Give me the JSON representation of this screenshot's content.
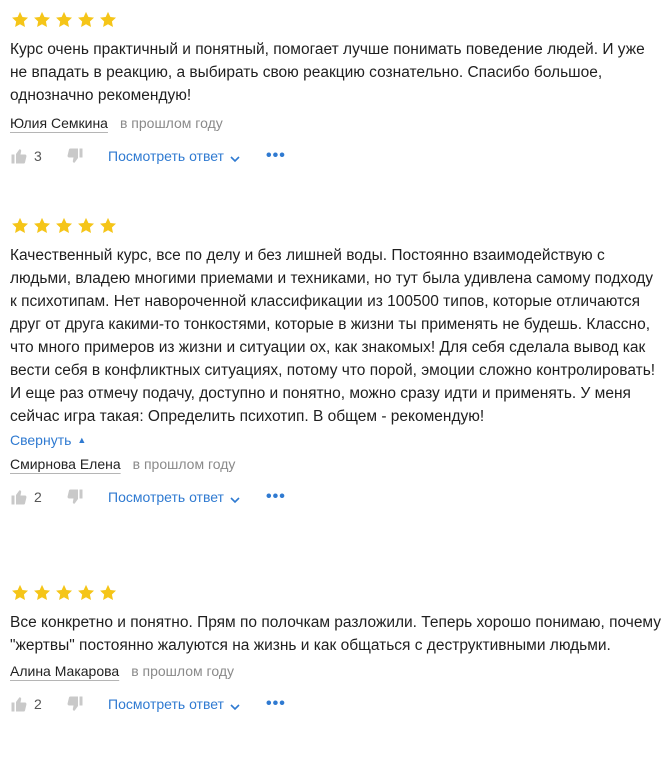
{
  "colors": {
    "star": "#f5c518",
    "link": "#2f7ad1",
    "icon": "#c9c9c9",
    "muted": "#8a8a8a"
  },
  "icons": {
    "star": "star-icon",
    "like": "thumbs-up-icon",
    "dislike": "thumbs-down-icon",
    "chevron": "chevron-down-icon",
    "more": "more-icon"
  },
  "reviews": [
    {
      "rating": 5,
      "text": "Курс очень практичный и понятный, помогает лучше понимать поведение людей. И уже не впадать в реакцию, а выбирать свою реакцию сознательно. Спасибо большое, однозначно рекомендую!",
      "author": "Юлия Семкина",
      "date": "в прошлом году",
      "likes": "3",
      "reply_label": "Посмотреть ответ",
      "more_label": "•••"
    },
    {
      "rating": 5,
      "text": "Качественный курс, все по делу и без лишней воды. Постоянно взаимодействую с людьми, владею многими приемами и техниками, но тут была удивлена самому подходу к психотипам. Нет навороченной классификации из 100500 типов, которые отличаются друг от друга какими-то тонкостями, которые в жизни ты применять не будешь. Классно, что много примеров из жизни и ситуации ох, как знакомых! Для себя сделала вывод как вести себя в конфликтных ситуациях, потому что порой, эмоции сложно контролировать! И еще раз отмечу подачу, доступно и понятно, можно сразу идти и применять. У меня сейчас игра такая: Определить психотип. В общем - рекомендую!",
      "collapse_label": "Свернуть",
      "author": "Смирнова Елена",
      "date": "в прошлом году",
      "likes": "2",
      "reply_label": "Посмотреть ответ",
      "more_label": "•••"
    },
    {
      "rating": 5,
      "text": "Все конкретно и понятно. Прям по полочкам разложили. Теперь хорошо понимаю, почему \"жертвы\" постоянно жалуются на жизнь и как общаться с деструктивными людьми.",
      "author": "Алина Макарова",
      "date": "в прошлом году",
      "likes": "2",
      "reply_label": "Посмотреть ответ",
      "more_label": "•••"
    }
  ]
}
